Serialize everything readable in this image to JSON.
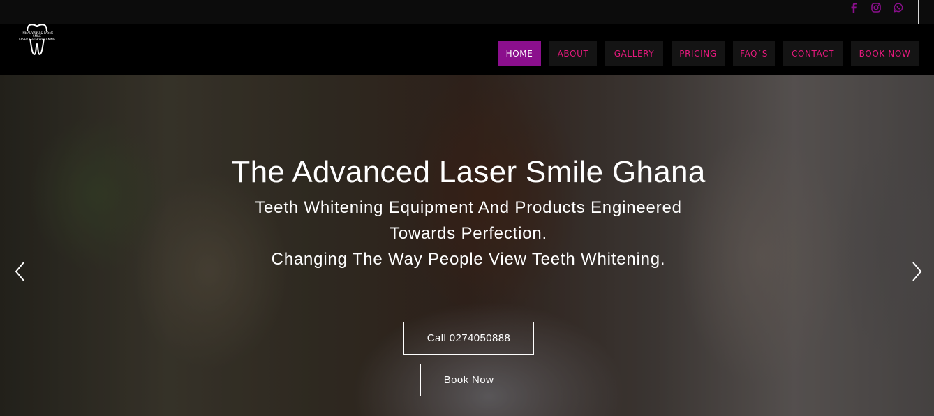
{
  "social": {
    "icons": [
      "facebook-icon",
      "instagram-icon",
      "whatsapp-icon"
    ],
    "color": "#8b0f8d"
  },
  "logo": {
    "icon": "tooth-icon",
    "text_line1": "THE ADVANCED LASER SMILE",
    "text_line2": "LASER TEETH WHITENING"
  },
  "nav": {
    "items": [
      {
        "label": "HOME",
        "active": true
      },
      {
        "label": "ABOUT",
        "active": false
      },
      {
        "label": "GALLERY",
        "active": false
      },
      {
        "label": "PRICING",
        "active": false
      },
      {
        "label": "FAQ´S",
        "active": false
      },
      {
        "label": "CONTACT",
        "active": false
      },
      {
        "label": "BOOK NOW",
        "active": false
      }
    ],
    "active_color": "#8b0f8d",
    "link_color": "#e5197d"
  },
  "hero": {
    "title": "The Advanced Laser Smile Ghana",
    "line1": "Teeth Whitening Equipment And Products Engineered",
    "line2": "Towards Perfection.",
    "line3": "Changing The Way People View Teeth Whitening.",
    "call_button": "Call 0274050888",
    "book_button": "Book Now",
    "prev_icon": "chevron-left-icon",
    "next_icon": "chevron-right-icon"
  }
}
